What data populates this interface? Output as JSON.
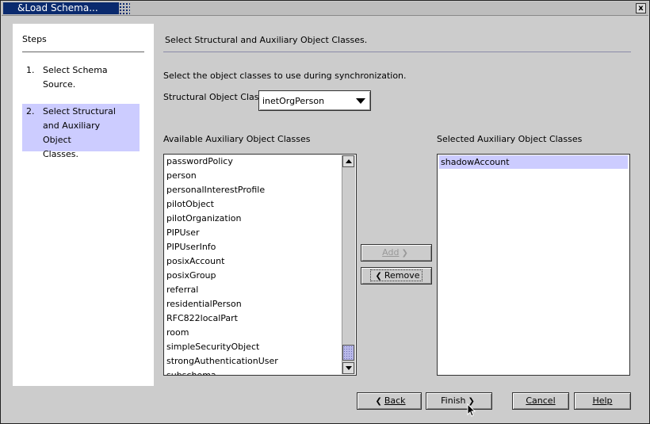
{
  "window": {
    "title": "&Load Schema...",
    "close_label": "x"
  },
  "steps": {
    "title": "Steps",
    "items": [
      {
        "num": "1.",
        "line1": "Select Schema",
        "line2": "Source.",
        "line3": ""
      },
      {
        "num": "2.",
        "line1": "Select Structural",
        "line2": "and Auxiliary Object",
        "line3": "Classes."
      }
    ]
  },
  "main": {
    "heading": "Select Structural and Auxiliary Object Classes.",
    "instruction": "Select the object classes to use during synchronization.",
    "structural_label": "Structural Object Class :",
    "structural_value": "inetOrgPerson",
    "available_label": "Available Auxiliary Object Classes",
    "selected_label": "Selected Auxiliary Object Classes",
    "available_items": [
      "passwordPolicy",
      "person",
      "personalInterestProfile",
      "pilotObject",
      "pilotOrganization",
      "PIPUser",
      "PIPUserInfo",
      "posixAccount",
      "posixGroup",
      "referral",
      "residentialPerson",
      "RFC822localPart",
      "room",
      "simpleSecurityObject",
      "strongAuthenticationUser",
      "subschema"
    ],
    "selected_items": [
      "shadowAccount"
    ],
    "add_label": "Add",
    "remove_label": "Remove"
  },
  "footer": {
    "back_label": "Back",
    "finish_label": "Finish",
    "cancel_label": "Cancel",
    "help_label": "Help"
  }
}
